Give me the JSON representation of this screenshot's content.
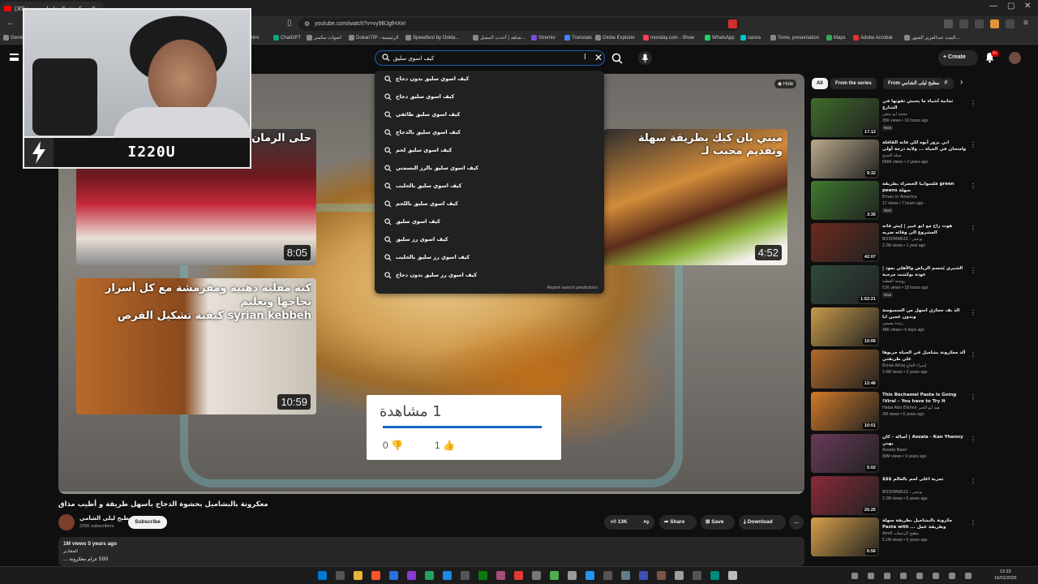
{
  "browser": {
    "tab_title": "(30) معكرونة بالبشاميل بحشوة ...",
    "url": "youtube.com/watch?v=vy9BJgfHXeI",
    "bookmarks": [
      "Gemini",
      "Google Gemini",
      "ChatGPT",
      "اصوات مكسر",
      "DokanTIP - الرئيسية",
      "Speedtest by Ookla...",
      "شاهد | أحدث المسل...",
      "Stremio",
      "Translate",
      "Globe Explorer",
      "monday.com - Show",
      "WhatsApp",
      "canva",
      "Tome, presentation",
      "Maps",
      "Adobe Acrobat",
      "البيت عبدالعزيز الشهر..."
    ]
  },
  "header": {
    "search_value": "كيف اسوي سليق",
    "create_label": "Create",
    "notif_count": "9+"
  },
  "suggestions": {
    "items": [
      "كيف اسوي سليق بدون دجاج",
      "كيف اسوي سليق دجاج",
      "كيف اسوي سليق طائفي",
      "كيف اسوي سليق بالدجاج",
      "كيف اسوي سليق لحم",
      "كيف اسوي سليق بالرز البسمتي",
      "كيف اسوي سليق بالحليب",
      "كيف اسوي سليق باللحم",
      "كيف اسوي سليق",
      "كيف اسوي رز سليق",
      "كيف اسوي رز سليق بالحليب",
      "كيف اسوي رز سليق بدون دجاج"
    ],
    "report": "Report search predictions"
  },
  "player": {
    "hide_label": "Hide",
    "endcards": [
      {
        "title": "حلى الرمان",
        "duration": "8:05"
      },
      {
        "title": "ميني بان كيك بطريقة سهلة وتقديم محبب لـ",
        "duration": "4:52"
      },
      {
        "title": "كبة مقلية ذهبية ومقرمشة مع كل أسرار نجاحها وتعليم",
        "subtitle": "syrian kebbeh كيفية تشكيل القرص",
        "duration": "10:59"
      }
    ],
    "overlay": {
      "count": "1 مشاهدة",
      "dislikes": "0",
      "likes": "1"
    }
  },
  "streamer": {
    "name": "I220U"
  },
  "video": {
    "title": "معكرونة بالبشاميل بحشوة الدجاج بأسهل طريقة و أطيب مذاق",
    "channel": "مطبخ ليلى الشامي",
    "subscribers": "225K subscribers",
    "subscribe_label": "Subscribe",
    "likes": "13K",
    "share_label": "Share",
    "save_label": "Save",
    "download_label": "Download",
    "views_date": "1M views  5 years ago",
    "desc_line1": "المقادير",
    "desc_line2": "500 غرام معكرونة ..."
  },
  "sidebar": {
    "chips": [
      "All",
      "From the series",
      "From مطبخ ليلى الشامي",
      "F"
    ],
    "recs": [
      {
        "title": "ثمانية أشياء ما يحبش تفوتها في الشارع",
        "channel": "محمد ابو شقير",
        "meta": "35K views • 16 hours ago",
        "duration": "17:12",
        "new": "New",
        "color": "#3f6b2a"
      },
      {
        "title": "ابي يزور أبوه لكن فاته القافلة وامتحان في الحياة ... ولاية درجة أولى",
        "channel": "شيلة الشيخ",
        "meta": "666K views • 2 years ago",
        "duration": "9:32",
        "new": "",
        "color": "#b9a98a"
      },
      {
        "title": "green فلسوانيا الخضراء بطريقة سهلة peans",
        "channel": "Eman in America",
        "meta": "17 views • 7 hours ago",
        "duration": "3:35",
        "new": "New",
        "color": "#3f7a2e"
      },
      {
        "title": "هوت راح مع ابو عبير | إيش فاته المشروع الى وقائه ضربه",
        "channel": "BO3OMAR22 - بوعمر",
        "meta": "2.2M views • 1 year ago",
        "duration": "42:07",
        "new": "",
        "color": "#6b2a1c"
      },
      {
        "title": "الشيري يُحسم الرياض والأهلي يعود | عودة بوكشت مرحبة",
        "channel": "روشنة الفطبة",
        "meta": "51K views • 18 hours ago",
        "duration": "1:52:21",
        "new": "New",
        "color": "#2f4a3c"
      },
      {
        "title": "الذ بف حجازي اسهل من السمبوسة وبدون عجين ايا",
        "channel": "رغدة نصيفي",
        "meta": "48K views • 6 days ago",
        "duration": "10:06",
        "new": "",
        "color": "#c89a4a"
      },
      {
        "title": "ألذ معكرونة بشاميل في الحياة جربوها على طريقتي",
        "channel": "Esraa Alhaj إسراء الحاج",
        "meta": "2.4M views • 3 years ago",
        "duration": "12:46",
        "new": "",
        "color": "#b06a2a"
      },
      {
        "title": "This Béchamel Pasta Is Going Viral – You have to Try It!",
        "channel": "Heba Abo Elkheir هبة أبو الخير",
        "meta": "2M views • 6 years ago",
        "duration": "10:01",
        "new": "",
        "color": "#d07a28"
      },
      {
        "title": "Assala - Kan Yhenny | أصالة - كان يهني",
        "channel": "Assala Nasri",
        "meta": "89M views • 9 years ago",
        "duration": "5:02",
        "new": "",
        "color": "#6a3a5a"
      },
      {
        "title": "تجربة اغلى لحم بالعالم $$$",
        "channel": "BO3OMAR22 - بوعمر",
        "meta": "2.2M views • 6 years ago",
        "duration": "26:25",
        "new": "",
        "color": "#8a2a3a"
      },
      {
        "title": "مكرونة بالبشاميل بطريقة سهلة وطريقة عمل ... Pasta with",
        "channel": "Amill مطبخ الرحمات",
        "meta": "5.1M views • 6 years ago",
        "duration": "6:56",
        "new": "",
        "color": "#d6a04a"
      }
    ]
  },
  "taskbar": {
    "time": "13:33",
    "date": "16/01/2026"
  }
}
